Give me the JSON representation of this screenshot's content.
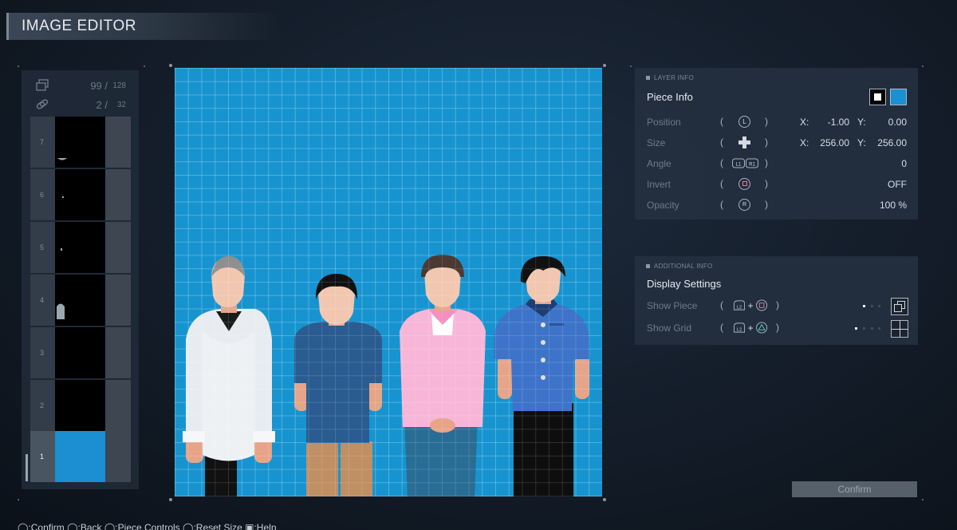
{
  "title": "IMAGE EDITOR",
  "counters": {
    "pieces": {
      "value": "99 /",
      "max": "128",
      "icon": "layers-icon"
    },
    "links": {
      "value": "2 /",
      "max": "32",
      "icon": "link-icon"
    }
  },
  "layers": [
    {
      "num": "7",
      "active": false
    },
    {
      "num": "6",
      "active": false
    },
    {
      "num": "5",
      "active": false
    },
    {
      "num": "4",
      "active": false
    },
    {
      "num": "3",
      "active": false
    },
    {
      "num": "2",
      "active": false
    },
    {
      "num": "1",
      "active": true
    }
  ],
  "layer_info": {
    "header": "LAYER INFO",
    "title": "Piece Info",
    "swatch_colors": [
      "#ffffff",
      "#1b8fd1"
    ],
    "rows": [
      {
        "label": "Position",
        "button": "L",
        "x_label": "X:",
        "x": "-1.00",
        "y_label": "Y:",
        "y": "0.00"
      },
      {
        "label": "Size",
        "button": "dpad",
        "x_label": "X:",
        "x": "256.00",
        "y_label": "Y:",
        "y": "256.00"
      },
      {
        "label": "Angle",
        "button": "L1R1",
        "value": "0"
      },
      {
        "label": "Invert",
        "button": "square",
        "value": "OFF"
      },
      {
        "label": "Opacity",
        "button": "R",
        "value": "100 %"
      }
    ]
  },
  "additional_info": {
    "header": "ADDITIONAL INFO",
    "title": "Display Settings",
    "rows": [
      {
        "label": "Show Piece",
        "combo_a": "L2",
        "combo_b": "square"
      },
      {
        "label": "Show Grid",
        "combo_a": "L2",
        "combo_b": "triangle"
      }
    ]
  },
  "confirm_label": "Confirm",
  "footer_text": "◯:Confirm ◯:Back ◯:Piece Controls ◯:Reset Size ▣:Help",
  "canvas_color": "#1794d0"
}
